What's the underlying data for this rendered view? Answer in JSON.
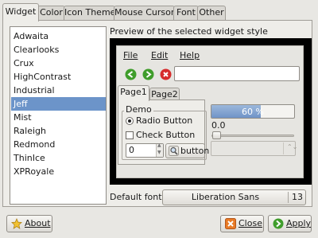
{
  "tabs": [
    "Widget",
    "Color",
    "Icon Theme",
    "Mouse Cursor",
    "Font",
    "Other"
  ],
  "active_tab": "Widget",
  "themes": [
    "Adwaita",
    "Clearlooks",
    "Crux",
    "HighContrast",
    "Industrial",
    "Jeff",
    "Mist",
    "Raleigh",
    "Redmond",
    "ThinIce",
    "XPRoyale"
  ],
  "selected_theme": "Jeff",
  "preview": {
    "label": "Preview of the selected widget style",
    "menu": [
      "File",
      "Edit",
      "Help"
    ],
    "notebook_tabs": [
      "Page1",
      "Page2"
    ],
    "frame_label": "Demo",
    "radio_label": "Radio Button",
    "check_label": "Check Button",
    "spin_value": "0",
    "button_label": "button",
    "progress_text": "60 %",
    "progress_fraction": 0.6,
    "scale_value": "0.0"
  },
  "default_font": {
    "label": "Default font:",
    "name": "Liberation Sans",
    "size": "13"
  },
  "buttons": {
    "about": "About",
    "close": "Close",
    "apply": "Apply"
  },
  "colors": {
    "selection": "#6c94c9",
    "progress": "#6f93c7",
    "stop": "#d62b2b",
    "nav_green": "#3f9d2b"
  },
  "icons": {
    "about": "about-icon",
    "close": "close-icon",
    "apply": "apply-icon",
    "back": "back-arrow-icon",
    "forward": "forward-arrow-icon",
    "stop": "stop-icon",
    "search": "search-icon"
  }
}
